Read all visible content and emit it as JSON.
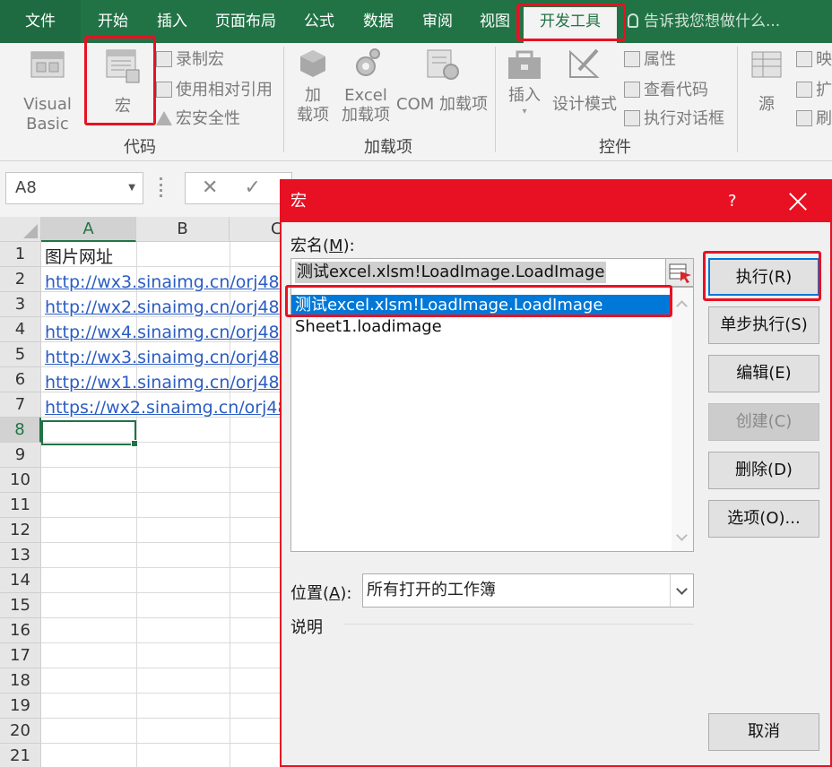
{
  "ribbon_tabs": [
    {
      "label": "文件"
    },
    {
      "label": "开始"
    },
    {
      "label": "插入"
    },
    {
      "label": "页面布局"
    },
    {
      "label": "公式"
    },
    {
      "label": "数据"
    },
    {
      "label": "审阅"
    },
    {
      "label": "视图"
    },
    {
      "label": "开发工具"
    }
  ],
  "tell_me": "告诉我您想做什么...",
  "ribbon": {
    "code_group": {
      "visual_basic": "Visual Basic",
      "macros": "宏",
      "record_macro": "录制宏",
      "relative_ref": "使用相对引用",
      "macro_security": "宏安全性",
      "group_label": "代码"
    },
    "addins_group": {
      "addins_line1": "加",
      "addins_line2": "载项",
      "excel_addins_line1": "Excel",
      "excel_addins_line2": "加载项",
      "com_addins": "COM 加载项",
      "group_label": "加载项"
    },
    "controls_group": {
      "insert": "插入",
      "design_mode": "设计模式",
      "properties": "属性",
      "view_code": "查看代码",
      "run_dialog": "执行对话框",
      "group_label": "控件"
    },
    "xml_group": {
      "source": "源",
      "map": "映",
      "expand": "扩",
      "refresh": "刷"
    }
  },
  "formula_bar": {
    "name_box": "A8"
  },
  "sheet": {
    "columns": [
      "A",
      "B",
      "C"
    ],
    "rows": [
      "1",
      "2",
      "3",
      "4",
      "5",
      "6",
      "7",
      "8",
      "9",
      "10",
      "11",
      "12",
      "13",
      "14",
      "15",
      "16",
      "17",
      "18",
      "19",
      "20",
      "21"
    ],
    "cells": [
      "图片网址",
      "http://wx3.sinaimg.cn/orj48",
      "http://wx2.sinaimg.cn/orj48",
      "http://wx4.sinaimg.cn/orj48",
      "http://wx3.sinaimg.cn/orj48",
      "http://wx1.sinaimg.cn/orj48",
      "https://wx2.sinaimg.cn/orj48"
    ]
  },
  "dialog": {
    "title": "宏",
    "help": "?",
    "macro_name_label": "宏名(",
    "macro_name_key": "M",
    "macro_name_suffix": "):",
    "macro_name_value": "测试excel.xlsm!LoadImage.LoadImage",
    "macro_list": [
      "测试excel.xlsm!LoadImage.LoadImage",
      "Sheet1.loadimage"
    ],
    "buttons": {
      "run": "执行(R)",
      "step_into": "单步执行(S)",
      "edit": "编辑(E)",
      "create": "创建(C)",
      "delete": "删除(D)",
      "options": "选项(O)...",
      "cancel": "取消"
    },
    "location_label": "位置(",
    "location_key": "A",
    "location_suffix": "):",
    "location_value": "所有打开的工作簿",
    "description_label": "说明"
  }
}
